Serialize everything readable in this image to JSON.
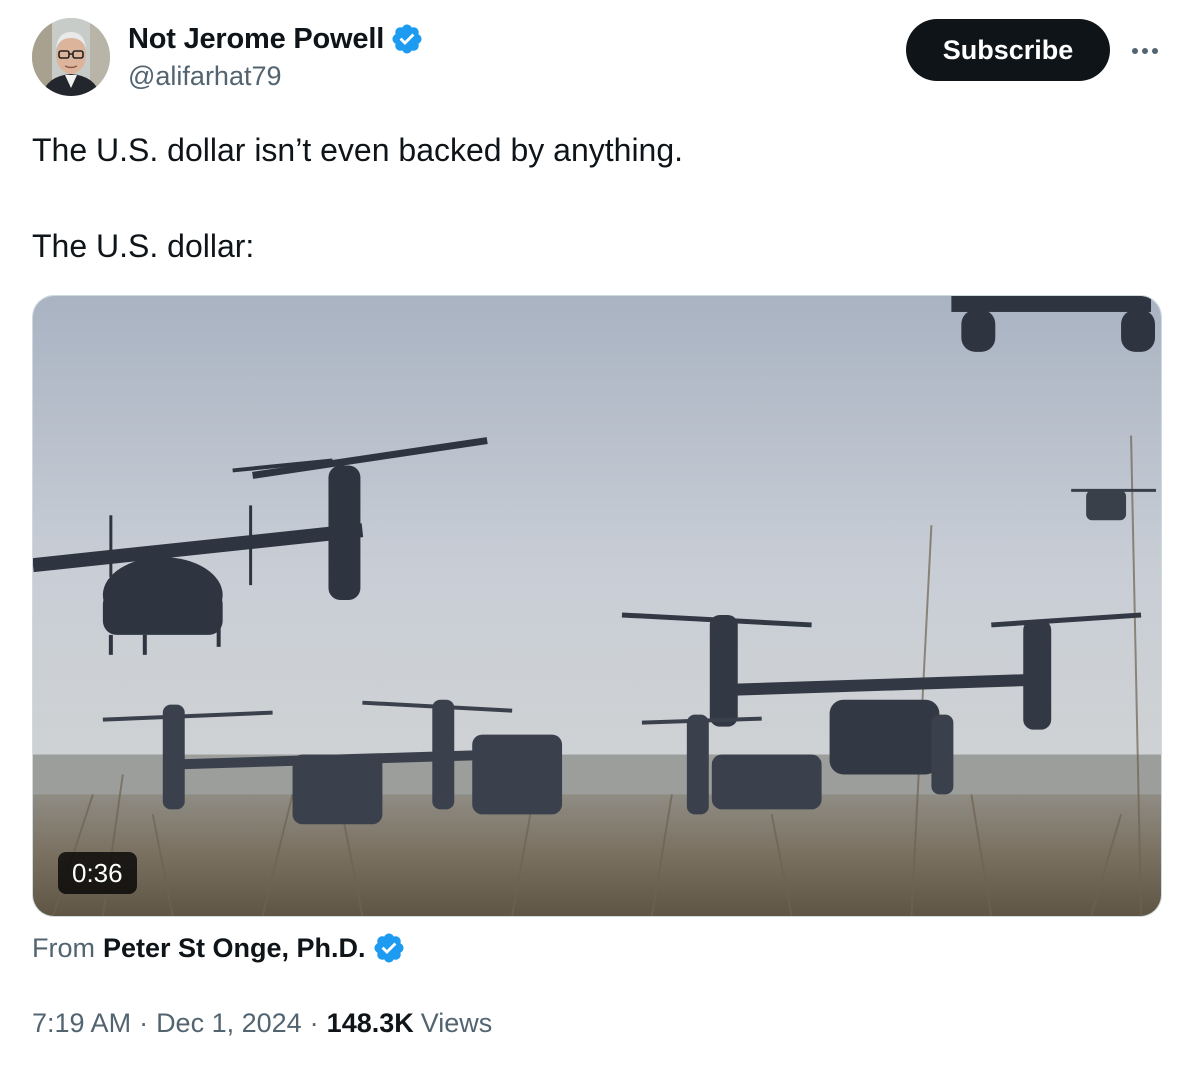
{
  "author": {
    "display_name": "Not Jerome Powell",
    "handle": "@alifarhat79",
    "verified": true
  },
  "actions": {
    "subscribe_label": "Subscribe",
    "more_icon": "more-horizontal-icon"
  },
  "tweet": {
    "lines": [
      "The U.S. dollar isn’t even backed by anything.",
      "The U.S. dollar:"
    ]
  },
  "media": {
    "type": "video",
    "duration": "0:36"
  },
  "attribution": {
    "prefix": "From",
    "name": "Peter St Onge, Ph.D.",
    "verified": true
  },
  "meta": {
    "time": "7:19 AM",
    "separator": "·",
    "date": "Dec 1, 2024",
    "views_count": "148.3K",
    "views_label": "Views"
  },
  "colors": {
    "text_primary": "#0f1419",
    "text_secondary": "#536471",
    "verified_blue": "#1d9bf0",
    "button_bg": "#0f1419"
  }
}
